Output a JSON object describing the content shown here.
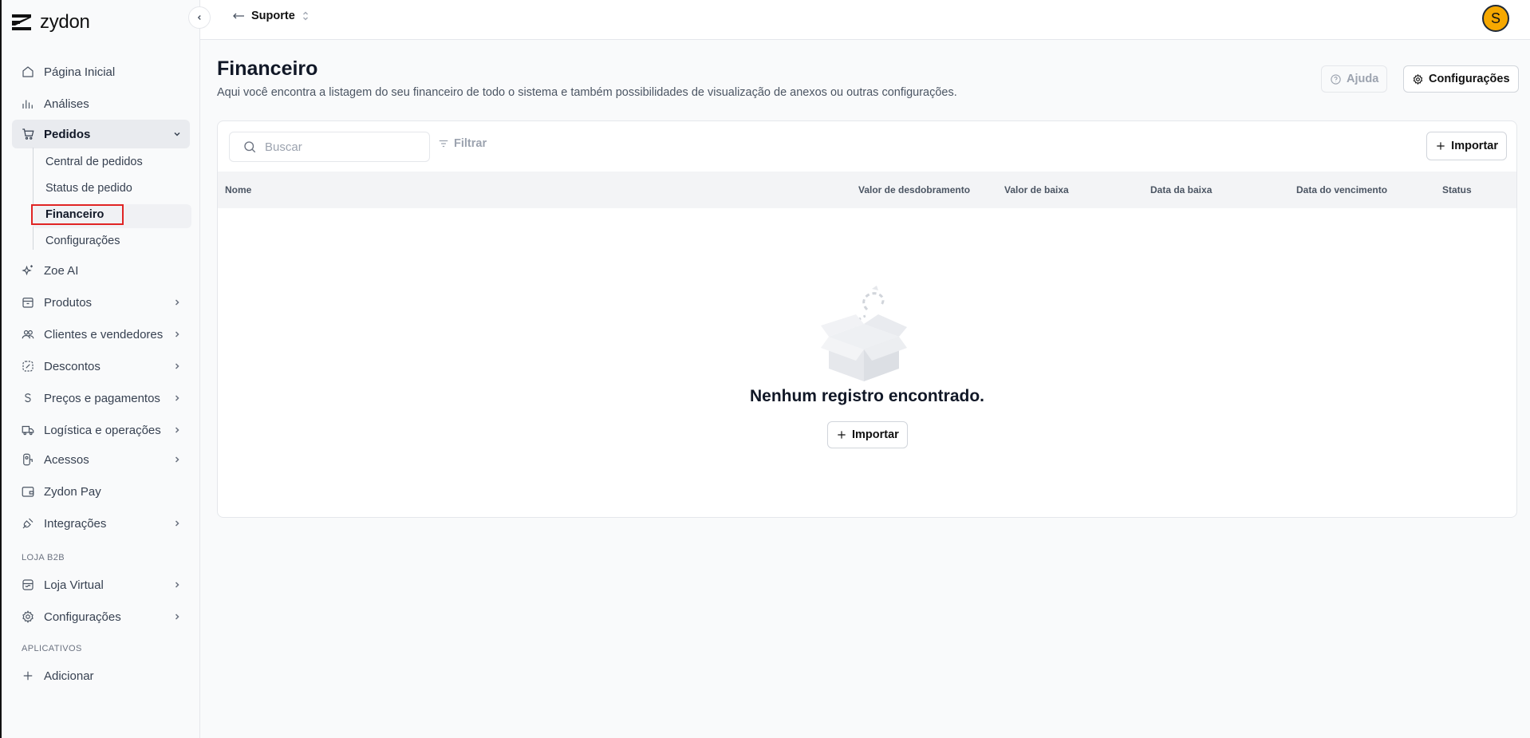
{
  "app": {
    "name": "zydon"
  },
  "topbar": {
    "breadcrumb": "Suporte",
    "avatar_initial": "S"
  },
  "sidebar": {
    "items": [
      {
        "label": "Página Inicial",
        "icon": "home-icon"
      },
      {
        "label": "Análises",
        "icon": "bar-chart-icon"
      },
      {
        "label": "Pedidos",
        "icon": "cart-icon",
        "expanded": true
      },
      {
        "label": "Zoe AI",
        "icon": "sparkle-icon"
      },
      {
        "label": "Produtos",
        "icon": "package-icon"
      },
      {
        "label": "Clientes e vendedores",
        "icon": "users-icon"
      },
      {
        "label": "Descontos",
        "icon": "discount-icon"
      },
      {
        "label": "Preços e pagamentos",
        "icon": "dollar-icon"
      },
      {
        "label": "Logística e operações",
        "icon": "truck-icon"
      },
      {
        "label": "Acessos",
        "icon": "key-icon"
      },
      {
        "label": "Zydon Pay",
        "icon": "wallet-icon"
      },
      {
        "label": "Integrações",
        "icon": "plug-icon"
      }
    ],
    "pedidos_sub": [
      "Central de pedidos",
      "Status de pedido",
      "Financeiro",
      "Configurações"
    ],
    "section_b2b": "LOJA B2B",
    "b2b_items": [
      {
        "label": "Loja Virtual",
        "icon": "store-icon"
      },
      {
        "label": "Configurações",
        "icon": "gear-icon"
      }
    ],
    "section_apps": "APLICATIVOS",
    "add_label": "Adicionar"
  },
  "page": {
    "title": "Financeiro",
    "description": "Aqui você encontra a listagem do seu financeiro de todo o sistema e também possibilidades de visualização de anexos ou outras configurações.",
    "help_label": "Ajuda",
    "settings_label": "Configurações"
  },
  "table": {
    "search_placeholder": "Buscar",
    "filter_label": "Filtrar",
    "import_label": "Importar",
    "columns": [
      "Nome",
      "Valor de desdobramento",
      "Valor de baixa",
      "Data da baixa",
      "Data do vencimento",
      "Status"
    ],
    "empty_message": "Nenhum registro encontrado.",
    "empty_import_label": "Importar"
  },
  "colors": {
    "accent_avatar": "#f6a800",
    "highlight": "#e02424"
  }
}
